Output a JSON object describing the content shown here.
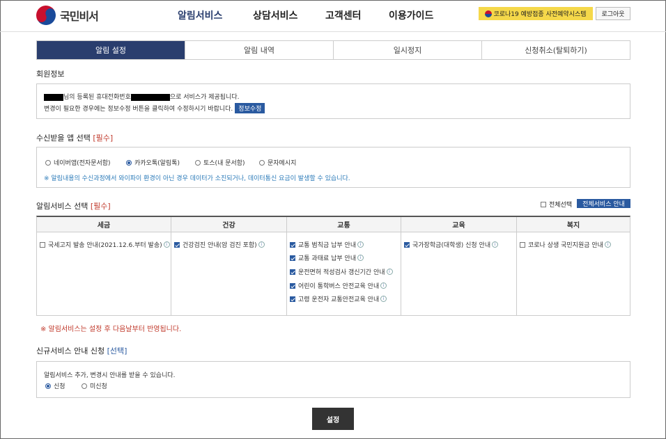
{
  "header": {
    "logo_text": "국민비서",
    "nav": [
      "알림서비스",
      "상담서비스",
      "고객센터",
      "이용가이드"
    ],
    "covid_button": "코로나19 예방접종 사전예약시스템",
    "logout_button": "로그아웃"
  },
  "tabs": [
    "알림 설정",
    "알림 내역",
    "일시정지",
    "신청취소(탈퇴하기)"
  ],
  "member": {
    "title": "회원정보",
    "line1_mid": "님의 등록된 휴대전화번호",
    "line1_end": "으로 서비스가 제공됩니다.",
    "line2": "변경이 필요한 경우에는 정보수정 버튼을 클릭하여 수정하시기 바랍니다.",
    "edit_button": "정보수정"
  },
  "app_select": {
    "title": "수신받을 앱 선택",
    "required": "[필수]",
    "options": [
      "네이버앱(전자문서함)",
      "카카오톡(알림톡)",
      "토스(내 문서함)",
      "문자메시지"
    ],
    "selected_index": 1,
    "note": "※ 알림내용의 수신과정에서 와이파이 환경이 아닌 경우 데이터가 소진되거나, 데이터통신 요금이 발생할 수 있습니다."
  },
  "service_select": {
    "title": "알림서비스 선택",
    "required": "[필수]",
    "select_all": "전체선택",
    "all_service_button": "전체서비스 안내",
    "columns": [
      {
        "head": "세금",
        "items": [
          {
            "label": "국세고지 발송 안내(2021.12.6.부터 발송)",
            "checked": false
          }
        ]
      },
      {
        "head": "건강",
        "items": [
          {
            "label": "건강검진 안내(암 검진 포함)",
            "checked": true
          }
        ]
      },
      {
        "head": "교통",
        "items": [
          {
            "label": "교통 범칙금 납부 안내",
            "checked": true
          },
          {
            "label": "교통 과태료 납부 안내",
            "checked": true
          },
          {
            "label": "운전면허 적성검사 갱신기간 안내",
            "checked": true
          },
          {
            "label": "어린이 통학버스 안전교육 안내",
            "checked": true
          },
          {
            "label": "고령 운전자 교통안전교육 안내",
            "checked": true
          }
        ]
      },
      {
        "head": "교육",
        "items": [
          {
            "label": "국가장학금(대학생) 신청 안내",
            "checked": true
          }
        ]
      },
      {
        "head": "복지",
        "items": [
          {
            "label": "코로나 상생 국민지원금 안내",
            "checked": false
          }
        ]
      }
    ],
    "note": "※ 알림서비스는 설정 후 다음날부터 반영됩니다."
  },
  "new_service": {
    "title": "신규서비스 안내 신청",
    "optional": "[선택]",
    "desc": "알림서비스 추가, 변경시 안내를 받을 수 있습니다.",
    "options": [
      "신청",
      "미신청"
    ],
    "selected_index": 0
  },
  "submit_button": "설정",
  "colors": {
    "primary": "#2a3e6e",
    "accent_blue": "#2a5aa0",
    "required_red": "#c0392b",
    "covid_yellow": "#f5d84a"
  }
}
